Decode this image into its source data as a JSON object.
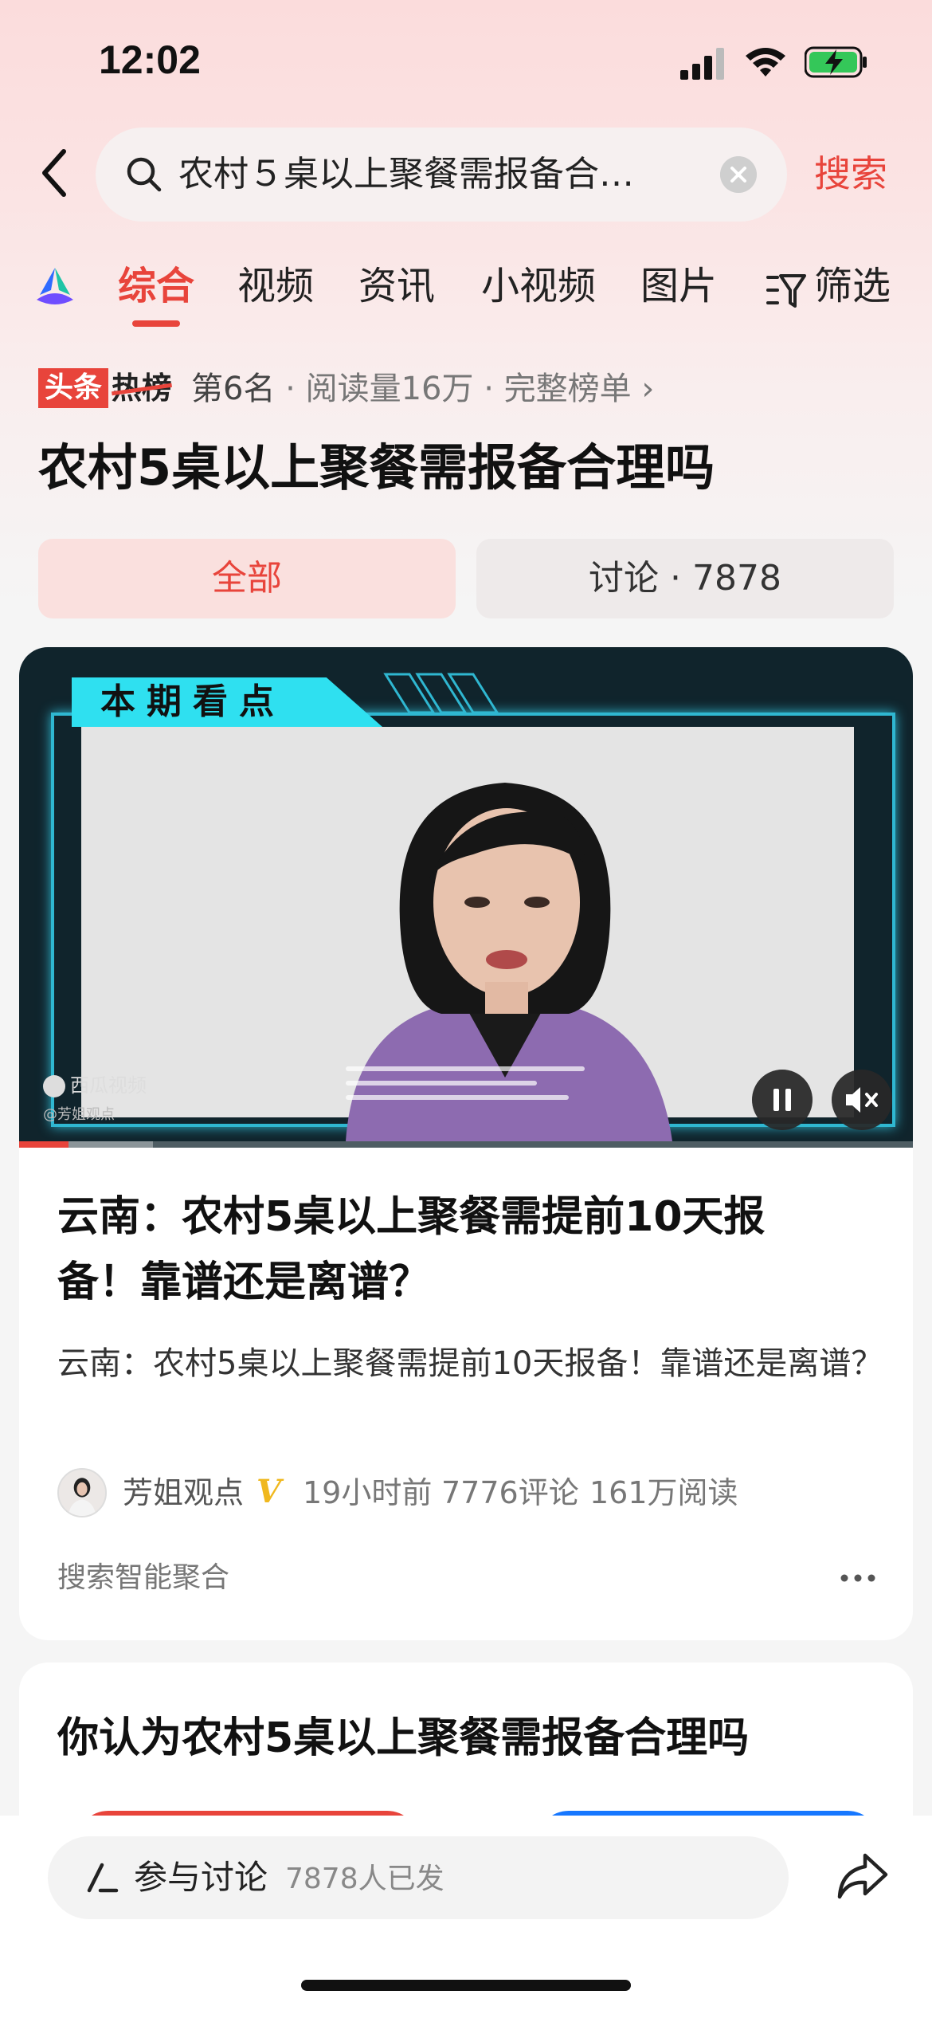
{
  "status_bar": {
    "time": "12:02"
  },
  "search": {
    "query": "农村５桌以上聚餐需报备合…",
    "button_label": "搜索"
  },
  "tabs": {
    "items": [
      {
        "label": "综合",
        "active": true
      },
      {
        "label": "视频"
      },
      {
        "label": "资讯"
      },
      {
        "label": "小视频"
      },
      {
        "label": "图片"
      }
    ],
    "filter_label": "筛选",
    "accent_color": "#e8443b"
  },
  "hot_board": {
    "badge_red": "头条",
    "badge_word": "热榜",
    "rank": "第6名",
    "reads": "· 阅读量16万 ·",
    "full_list": "完整榜单",
    "arrow": "›"
  },
  "topic": {
    "title": "农村5桌以上聚餐需报备合理吗"
  },
  "segments": {
    "all": "全部",
    "discuss": "讨论 · 7878"
  },
  "video": {
    "label": "本期看点",
    "platform": "西瓜视频",
    "watermark": "@芳姐观点",
    "progress": 0.055,
    "buffered": 0.15
  },
  "article": {
    "title": "云南：农村5桌以上聚餐需提前10天报备！靠谱还是离谱？",
    "summary": "云南：农村5桌以上聚餐需提前10天报备！靠谱还是离谱？",
    "author": "芳姐观点",
    "verified_mark": "V",
    "time": "19小时前",
    "comments": "7776评论",
    "reads": "161万阅读",
    "source": "搜索智能聚合"
  },
  "poll": {
    "title": "你认为农村5桌以上聚餐需报备合理吗"
  },
  "bottom": {
    "discuss_label": "参与讨论",
    "discuss_count": "7878人已发"
  }
}
